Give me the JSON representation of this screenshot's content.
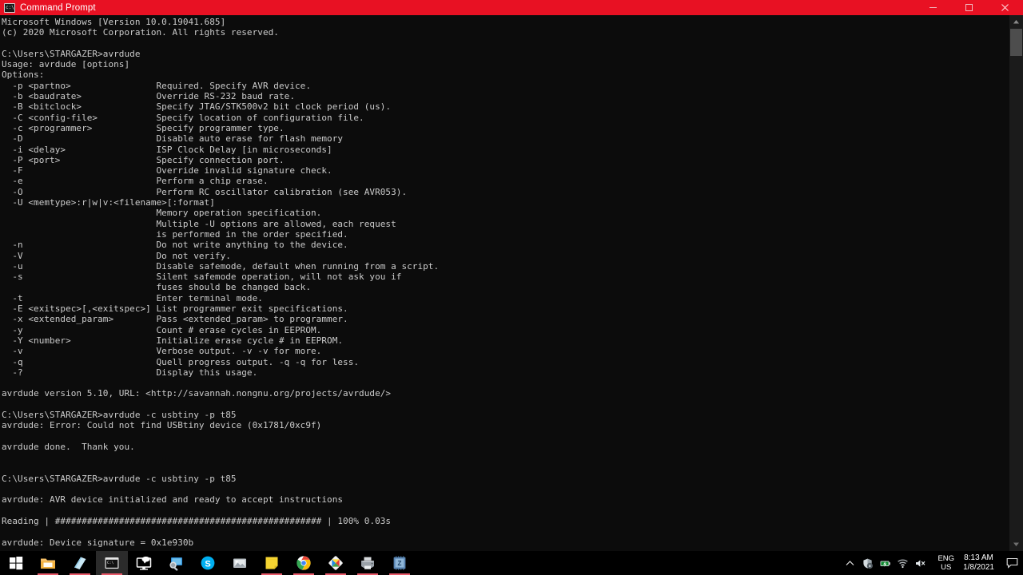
{
  "window": {
    "title": "Command Prompt",
    "icon": "console-icon",
    "titlebar_color": "#e81123",
    "minimize_label": "Minimize",
    "maximize_label": "Maximize",
    "close_label": "Close"
  },
  "console": {
    "background_color": "#0c0c0c",
    "text_color": "#cccccc",
    "lines": [
      "Microsoft Windows [Version 10.0.19041.685]",
      "(c) 2020 Microsoft Corporation. All rights reserved.",
      "",
      "C:\\Users\\STARGAZER>avrdude",
      "Usage: avrdude [options]",
      "Options:",
      "  -p <partno>                Required. Specify AVR device.",
      "  -b <baudrate>              Override RS-232 baud rate.",
      "  -B <bitclock>              Specify JTAG/STK500v2 bit clock period (us).",
      "  -C <config-file>           Specify location of configuration file.",
      "  -c <programmer>            Specify programmer type.",
      "  -D                         Disable auto erase for flash memory",
      "  -i <delay>                 ISP Clock Delay [in microseconds]",
      "  -P <port>                  Specify connection port.",
      "  -F                         Override invalid signature check.",
      "  -e                         Perform a chip erase.",
      "  -O                         Perform RC oscillator calibration (see AVR053).",
      "  -U <memtype>:r|w|v:<filename>[:format]",
      "                             Memory operation specification.",
      "                             Multiple -U options are allowed, each request",
      "                             is performed in the order specified.",
      "  -n                         Do not write anything to the device.",
      "  -V                         Do not verify.",
      "  -u                         Disable safemode, default when running from a script.",
      "  -s                         Silent safemode operation, will not ask you if",
      "                             fuses should be changed back.",
      "  -t                         Enter terminal mode.",
      "  -E <exitspec>[,<exitspec>] List programmer exit specifications.",
      "  -x <extended_param>        Pass <extended_param> to programmer.",
      "  -y                         Count # erase cycles in EEPROM.",
      "  -Y <number>                Initialize erase cycle # in EEPROM.",
      "  -v                         Verbose output. -v -v for more.",
      "  -q                         Quell progress output. -q -q for less.",
      "  -?                         Display this usage.",
      "",
      "avrdude version 5.10, URL: <http://savannah.nongnu.org/projects/avrdude/>",
      "",
      "C:\\Users\\STARGAZER>avrdude -c usbtiny -p t85",
      "avrdude: Error: Could not find USBtiny device (0x1781/0xc9f)",
      "",
      "avrdude done.  Thank you.",
      "",
      "",
      "C:\\Users\\STARGAZER>avrdude -c usbtiny -p t85",
      "",
      "avrdude: AVR device initialized and ready to accept instructions",
      "",
      "Reading | ################################################## | 100% 0.03s",
      "",
      "avrdude: Device signature = 0x1e930b"
    ]
  },
  "scrollbar": {
    "up_arrow": "chevron-up-icon",
    "down_arrow": "chevron-down-icon"
  },
  "taskbar": {
    "items": [
      {
        "name": "start-button",
        "icon": "windows-logo-icon",
        "active": false,
        "running": false
      },
      {
        "name": "file-explorer",
        "icon": "folder-icon",
        "active": false,
        "running": true
      },
      {
        "name": "microsoft-store",
        "icon": "store-icon",
        "active": false,
        "running": true
      },
      {
        "name": "command-prompt",
        "icon": "console-icon",
        "active": true,
        "running": true
      },
      {
        "name": "remote-desktop",
        "icon": "monitor-icon",
        "active": false,
        "running": false
      },
      {
        "name": "screen-app",
        "icon": "screen-search-icon",
        "active": false,
        "running": false
      },
      {
        "name": "skype",
        "icon": "skype-icon",
        "active": false,
        "running": false
      },
      {
        "name": "photos-app",
        "icon": "photos-icon",
        "active": false,
        "running": false
      },
      {
        "name": "sticky-notes",
        "icon": "sticky-note-icon",
        "active": false,
        "running": true
      },
      {
        "name": "google-chrome",
        "icon": "chrome-icon",
        "active": false,
        "running": true
      },
      {
        "name": "design-app",
        "icon": "diamond-icon",
        "active": false,
        "running": true
      },
      {
        "name": "printer-app",
        "icon": "printer-icon",
        "active": false,
        "running": true
      },
      {
        "name": "arduino-app",
        "icon": "chip-icon",
        "active": false,
        "running": true
      }
    ],
    "tray": {
      "show_hidden": "chevron-up-icon",
      "icons": [
        "security-shield-icon",
        "battery-icon",
        "wifi-icon",
        "speaker-muted-icon"
      ],
      "language_line1": "ENG",
      "language_line2": "US",
      "time": "8:13 AM",
      "date": "1/8/2021",
      "notifications": "notification-icon"
    }
  }
}
